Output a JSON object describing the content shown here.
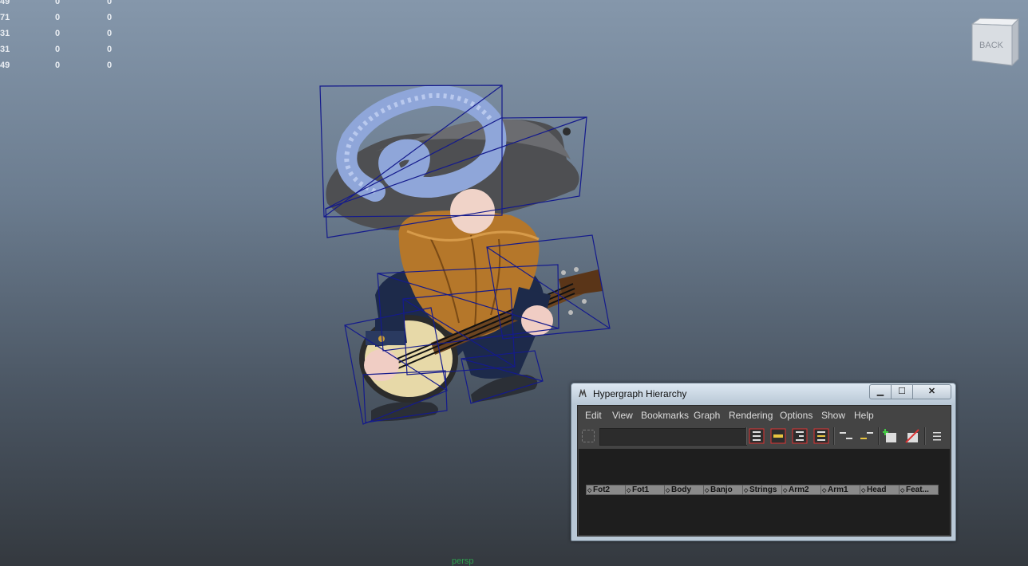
{
  "hud": {
    "rows": [
      [
        "49",
        "0",
        "0"
      ],
      [
        "71",
        "0",
        "0"
      ],
      [
        "31",
        "0",
        "0"
      ],
      [
        "31",
        "0",
        "0"
      ],
      [
        "49",
        "0",
        "0"
      ]
    ]
  },
  "viewcube": {
    "face_label": "BACK"
  },
  "camera_label": "persp",
  "hypergraph": {
    "title": "Hypergraph Hierarchy",
    "window_buttons": {
      "minimize": "▁",
      "maximize": "☐",
      "close": "✕"
    },
    "menu": [
      "Edit",
      "View",
      "Bookmarks",
      "Graph",
      "Rendering",
      "Options",
      "Show",
      "Help"
    ],
    "search_value": "",
    "nodes": [
      "Fot2",
      "Fot1",
      "Body",
      "Banjo",
      "Strings",
      "Arm2",
      "Arm1",
      "Head",
      "Feat..."
    ]
  },
  "colors": {
    "bounding_box": "#141a8c",
    "feather": "#8fa6d9",
    "hat": "#5a5a5a",
    "beard": "#b5772a",
    "skin": "#f0d3c8",
    "coat": "#1d2a4a",
    "node_fill": "#8a8a8a",
    "graph_bg": "#1e1e1e"
  }
}
